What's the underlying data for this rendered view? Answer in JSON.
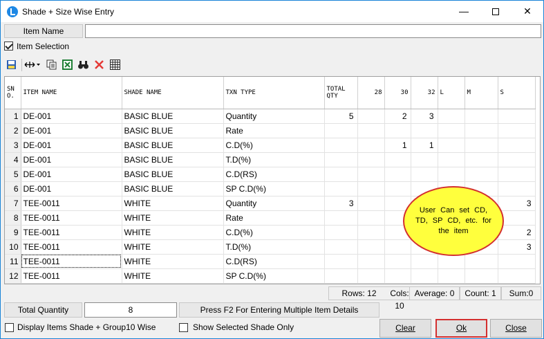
{
  "window": {
    "title": "Shade + Size Wise Entry",
    "minimize_glyph": "—",
    "close_glyph": "✕"
  },
  "item_name": {
    "label": "Item Name",
    "value": ""
  },
  "item_selection": {
    "label": "Item Selection",
    "checked": true
  },
  "toolbar": {
    "icons": [
      "save-icon",
      "column-resize-icon",
      "copy-icon",
      "excel-export-icon",
      "find-icon",
      "delete-icon",
      "grid-icon"
    ]
  },
  "grid": {
    "columns": [
      "SN O.",
      "ITEM NAME",
      "SHADE NAME",
      "TXN TYPE",
      "TOTAL QTY",
      "28",
      "30",
      "32",
      "L",
      "M",
      "S"
    ],
    "rows": [
      [
        "1",
        "DE-001",
        "BASIC BLUE",
        "Quantity",
        "5",
        "",
        "2",
        "3",
        "",
        "",
        ""
      ],
      [
        "2",
        "DE-001",
        "BASIC BLUE",
        "Rate",
        "",
        "",
        "",
        "",
        "",
        "",
        ""
      ],
      [
        "3",
        "DE-001",
        "BASIC BLUE",
        "C.D(%)",
        "",
        "",
        "1",
        "1",
        "",
        "",
        ""
      ],
      [
        "4",
        "DE-001",
        "BASIC BLUE",
        "T.D(%)",
        "",
        "",
        "",
        "",
        "",
        "",
        ""
      ],
      [
        "5",
        "DE-001",
        "BASIC BLUE",
        "C.D(RS)",
        "",
        "",
        "",
        "",
        "",
        "",
        ""
      ],
      [
        "6",
        "DE-001",
        "BASIC BLUE",
        "SP C.D(%)",
        "",
        "",
        "",
        "",
        "",
        "",
        ""
      ],
      [
        "7",
        "TEE-0011",
        "WHITE",
        "Quantity",
        "3",
        "",
        "",
        "",
        "",
        "",
        "3"
      ],
      [
        "8",
        "TEE-0011",
        "WHITE",
        "Rate",
        "",
        "",
        "",
        "",
        "",
        "",
        ""
      ],
      [
        "9",
        "TEE-0011",
        "WHITE",
        "C.D(%)",
        "",
        "",
        "",
        "",
        "",
        "",
        "2"
      ],
      [
        "10",
        "TEE-0011",
        "WHITE",
        "T.D(%)",
        "",
        "",
        "",
        "",
        "",
        "",
        "3"
      ],
      [
        "11",
        "TEE-0011",
        "WHITE",
        "C.D(RS)",
        "",
        "",
        "",
        "",
        "",
        "",
        ""
      ],
      [
        "12",
        "TEE-0011",
        "WHITE",
        "SP C.D(%)",
        "",
        "",
        "",
        "",
        "",
        "",
        ""
      ]
    ]
  },
  "annotation": {
    "text": "User Can set CD, TD, SP CD, etc. for the item"
  },
  "status": {
    "rows": "Rows: 12",
    "cols": "Cols: 10",
    "average": "Average: 0",
    "count": "Count: 1",
    "sum": "Sum:0"
  },
  "totals": {
    "label": "Total Quantity",
    "value": "8",
    "hint": "Press F2 For Entering Multiple Item Details"
  },
  "options": {
    "display_group": "Display Items Shade + Group10 Wise",
    "show_selected": "Show Selected Shade Only"
  },
  "buttons": {
    "clear": "Clear",
    "ok": "Ok",
    "close": "Close"
  },
  "colors": {
    "annotation_fill": "#ffff3d",
    "annotation_border": "#d32f2f",
    "window_border": "#1883d7"
  }
}
